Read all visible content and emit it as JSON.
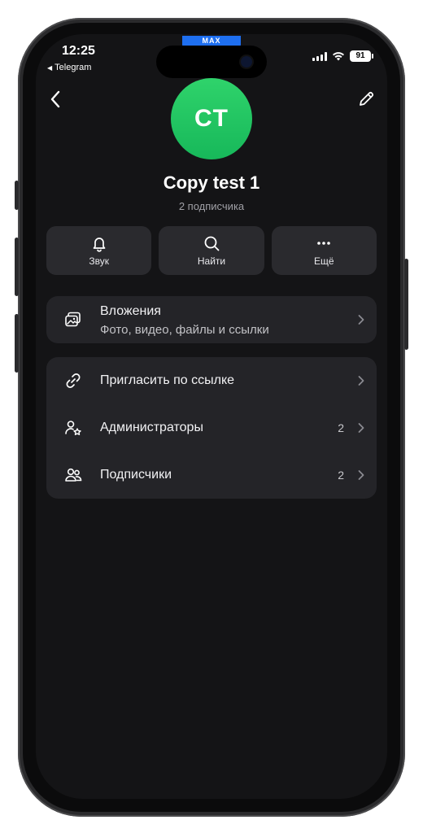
{
  "status_bar": {
    "time": "12:25",
    "back_app": "Telegram",
    "battery": "91",
    "top_badge": "MAX"
  },
  "profile": {
    "avatar_initials": "CT",
    "name": "Copy test 1",
    "subscribers_text": "2 подписчика"
  },
  "actions": [
    {
      "label": "Звук",
      "icon": "bell-icon"
    },
    {
      "label": "Найти",
      "icon": "search-icon"
    },
    {
      "label": "Ещё",
      "icon": "more-icon"
    }
  ],
  "attachments": {
    "title": "Вложения",
    "subtitle": "Фото, видео, файлы и ссылки",
    "icon": "gallery-icon"
  },
  "settings": [
    {
      "label": "Пригласить по ссылке",
      "count": "",
      "icon": "link-icon"
    },
    {
      "label": "Администраторы",
      "count": "2",
      "icon": "admin-icon"
    },
    {
      "label": "Подписчики",
      "count": "2",
      "icon": "users-icon"
    }
  ],
  "colors": {
    "avatar": "#22c55e",
    "background": "#141416",
    "card": "#242428"
  }
}
